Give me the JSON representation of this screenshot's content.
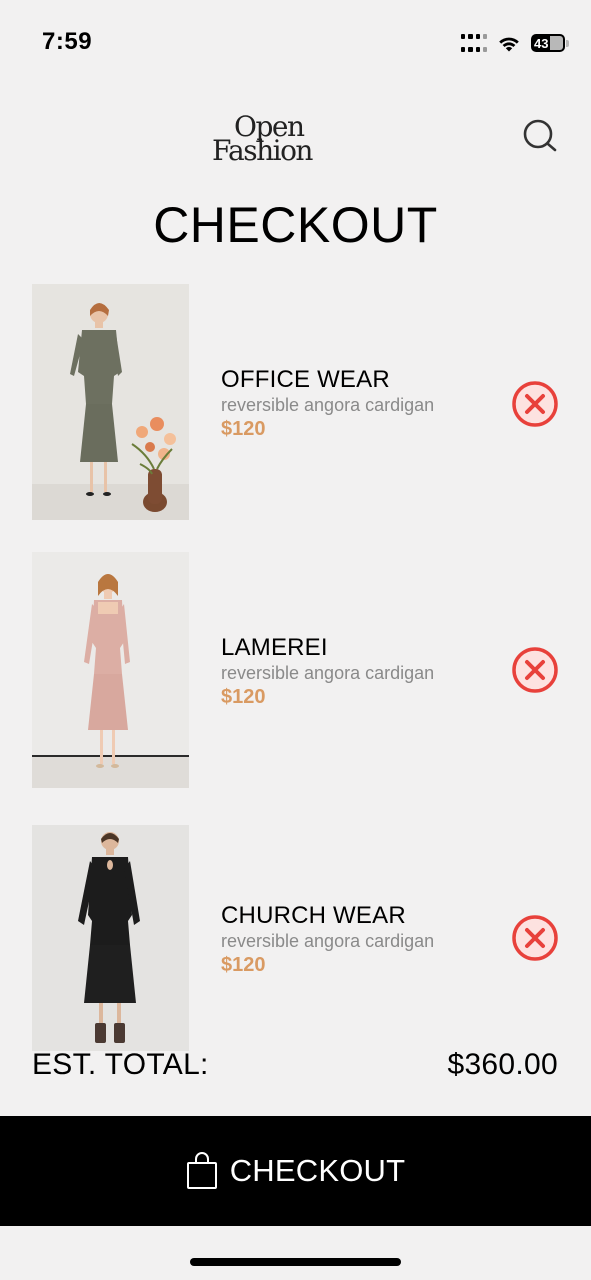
{
  "status_bar": {
    "time": "7:59",
    "battery": "43",
    "icons": [
      "signal-icon",
      "wifi-icon",
      "battery-icon"
    ]
  },
  "header": {
    "logo_line1": "Open",
    "logo_line2": "Fashion",
    "search_icon": "search-icon"
  },
  "page_title": "CHECKOUT",
  "cart": {
    "items": [
      {
        "name": "OFFICE WEAR",
        "description": "reversible angora cardigan",
        "price": "$120",
        "photo": "olive-suit-dress-model",
        "remove_icon": "close-circle-icon"
      },
      {
        "name": "LAMEREI",
        "description": "reversible angora cardigan",
        "price": "$120",
        "photo": "pink-dress-model",
        "remove_icon": "close-circle-icon"
      },
      {
        "name": "CHURCH WEAR",
        "description": "reversible angora cardigan",
        "price": "$120",
        "photo": "black-dress-model",
        "remove_icon": "close-circle-icon"
      }
    ]
  },
  "total": {
    "label": "EST. TOTAL:",
    "value": "$360.00"
  },
  "checkout_button": {
    "label": "CHECKOUT",
    "icon": "shopping-bag-icon"
  },
  "colors": {
    "background": "#f2f1f1",
    "price": "#d99a62",
    "remove": "#e8413b",
    "checkout_bar": "#000000"
  }
}
